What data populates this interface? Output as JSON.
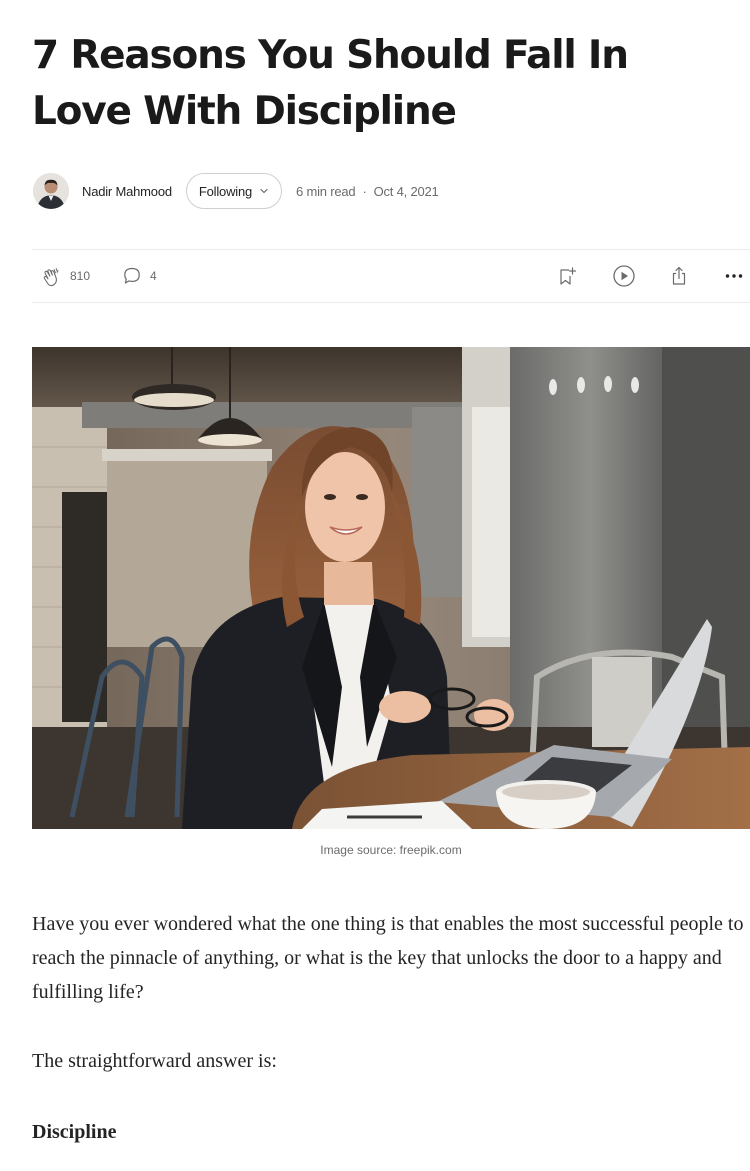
{
  "article": {
    "title": "7 Reasons You Should Fall In Love With Discipline"
  },
  "byline": {
    "author_name": "Nadir Mahmood",
    "follow_label": "Following",
    "read_time": "6 min read",
    "separator": "·",
    "date": "Oct 4, 2021"
  },
  "actions": {
    "claps": "810",
    "responses": "4",
    "icons": [
      "clap-icon",
      "comment-icon",
      "bookmark-add-icon",
      "play-icon",
      "share-icon",
      "more-icon"
    ]
  },
  "hero": {
    "caption": "Image source: freepik.com"
  },
  "body": {
    "paragraph_1": "Have you ever wondered what the one thing is that enables the most successful people to reach the pinnacle of anything, or what is the key that unlocks the door to a happy and fulfilling life?",
    "paragraph_2": "The straightforward answer is:",
    "paragraph_3": "Discipline"
  },
  "colors": {
    "text": "#242424",
    "muted": "#6b6b6b",
    "divider": "#ececec",
    "border": "#cfcfcf"
  }
}
